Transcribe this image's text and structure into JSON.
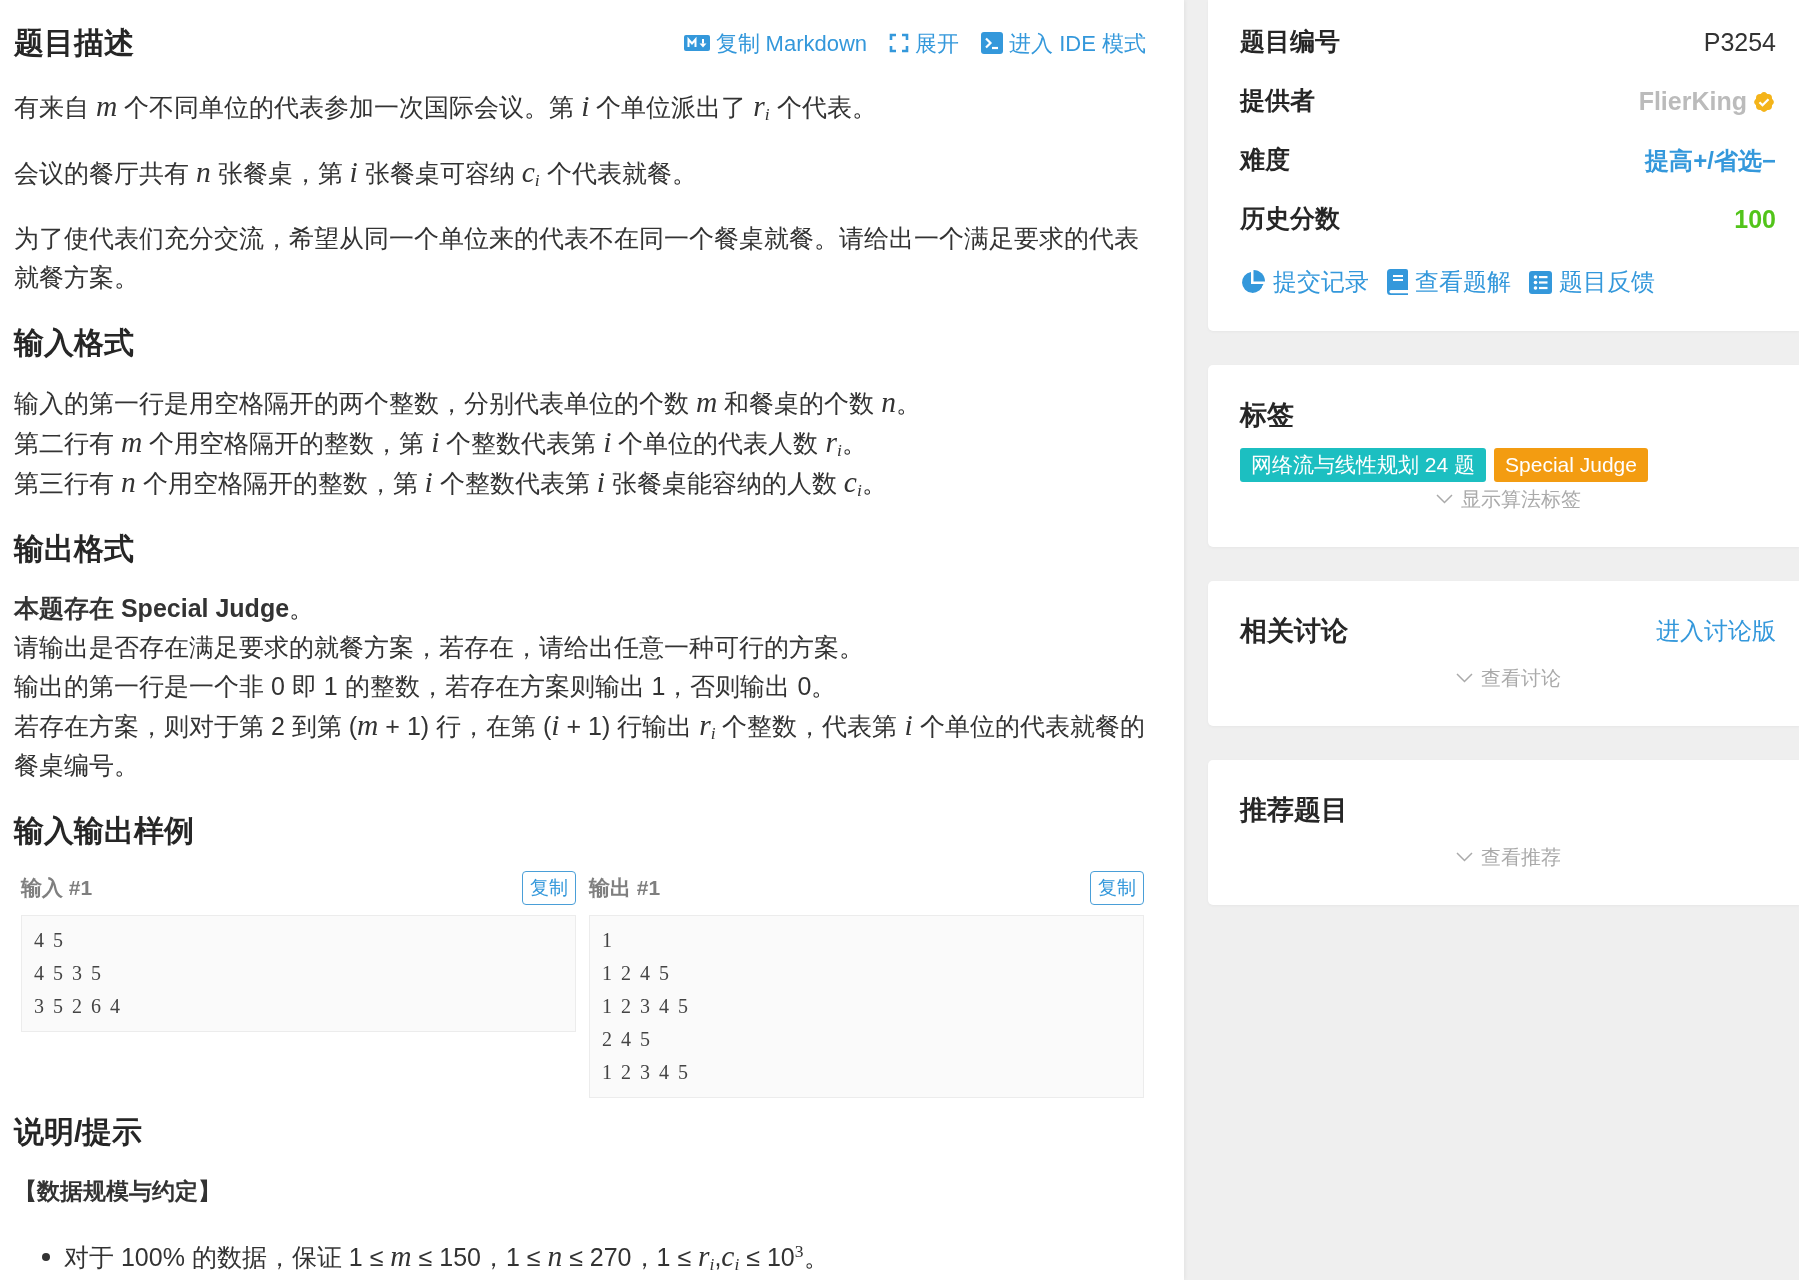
{
  "problem": {
    "sections": [
      {
        "kind": "text",
        "title": "题目描述",
        "actions": [
          {
            "kind": "markdown",
            "label": "复制 Markdown"
          },
          {
            "kind": "expand",
            "label": "展开"
          },
          {
            "kind": "ide",
            "label": "进入 IDE 模式"
          }
        ],
        "blocks": [
          {
            "kind": "paragraph",
            "lines": [
              "有来自 *m* 个不同单位的代表参加一次国际会议。第 *i* 个单位派出了 *r*$_{i}$ 个代表。"
            ]
          },
          {
            "kind": "paragraph",
            "lines": [
              "会议的餐厅共有 *n* 张餐桌，第 *i* 张餐桌可容纳 *c*$_{i}$ 个代表就餐。"
            ]
          },
          {
            "kind": "paragraph",
            "lines": [
              "为了使代表们充分交流，希望从同一个单位来的代表不在同一个餐桌就餐。请给出一个满足要求的代表就餐方案。"
            ]
          }
        ]
      },
      {
        "kind": "text",
        "title": "输入格式",
        "blocks": [
          {
            "kind": "paragraph",
            "lines": [
              "输入的第一行是用空格隔开的两个整数，分别代表单位的个数 *m* 和餐桌的个数 *n*。",
              "第二行有 *m* 个用空格隔开的整数，第 *i* 个整数代表第 *i* 个单位的代表人数 *r*$_{i}$。",
              "第三行有 *n* 个用空格隔开的整数，第 *i* 个整数代表第 *i* 张餐桌能容纳的人数 *c*$_{i}$。"
            ]
          }
        ]
      },
      {
        "kind": "text",
        "title": "输出格式",
        "blocks": [
          {
            "kind": "paragraph",
            "lines": [
              "**本题存在 Special Judge**。",
              "请输出是否存在满足要求的就餐方案，若存在，请给出任意一种可行的方案。",
              "输出的第一行是一个非 0 即 1 的整数，若存在方案则输出 1，否则输出 0。",
              "若存在方案，则对于第 2 到第 (*m* + 1) 行，在第 (*i* + 1) 行输出 *r*$_{i}$ 个整数，代表第 *i* 个单位的代表就餐的餐桌编号。"
            ]
          }
        ]
      },
      {
        "kind": "samples",
        "title": "输入输出样例",
        "samples": [
          {
            "label": "输入 #1",
            "copy_button": "复制",
            "lines": [
              "4 5",
              "4 5 3 5",
              "3 5 2 6 4"
            ]
          },
          {
            "label": "输出 #1",
            "copy_button": "复制",
            "lines": [
              "1",
              "1 2 4 5",
              "1 2 3 4 5",
              "2 4 5",
              "1 2 3 4 5"
            ]
          }
        ]
      },
      {
        "kind": "text",
        "title": "说明/提示",
        "blocks": [
          {
            "kind": "subheading",
            "text": "【数据规模与约定】"
          },
          {
            "kind": "bullets",
            "items": [
              "对于 100% 的数据，保证 1 ≤ *m* ≤ 150，1 ≤ *n* ≤ 270，1 ≤ *r*$_{i}$,*c*$_{i}$ ≤ 10$^{3}$。"
            ]
          }
        ]
      }
    ]
  },
  "sidebar": {
    "info": {
      "rows": [
        {
          "kind": "id",
          "label": "题目编号",
          "value": "P3254"
        },
        {
          "kind": "provider",
          "label": "提供者",
          "value": "FlierKing",
          "verified": true
        },
        {
          "kind": "difficulty",
          "label": "难度",
          "value": "提高+/省选−"
        },
        {
          "kind": "score",
          "label": "历史分数",
          "value": "100"
        }
      ],
      "links": [
        {
          "kind": "records",
          "label": "提交记录"
        },
        {
          "kind": "solutions",
          "label": "查看题解"
        },
        {
          "kind": "feedback",
          "label": "题目反馈"
        }
      ]
    },
    "tags": {
      "title": "标签",
      "items": [
        {
          "label": "网络流与线性规划 24 题",
          "color": "#1cbfc1"
        },
        {
          "label": "Special Judge",
          "color": "#f39c11"
        }
      ],
      "toggle": "显示算法标签"
    },
    "discussion": {
      "title": "相关讨论",
      "link": "进入讨论版",
      "toggle": "查看讨论"
    },
    "recommend": {
      "title": "推荐题目",
      "toggle": "查看推荐"
    }
  }
}
